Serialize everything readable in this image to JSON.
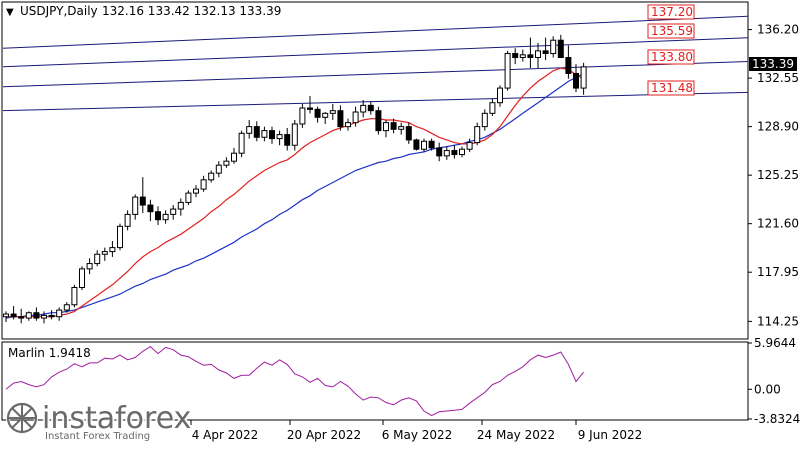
{
  "header": {
    "arrow": "▼",
    "symbol_tf": "USDJPY,Daily",
    "ohlc": "132.16 133.42 132.13 133.39"
  },
  "indicator": {
    "title": "Marlin 1.9418"
  },
  "watermark": {
    "brand": "instaforex",
    "tagline": "Instant Forex Trading"
  },
  "colors": {
    "background": "#ffffff",
    "grid": "#000000",
    "candle": "#000000",
    "ma_fast": "#e0201f",
    "ma_slow": "#1e33c8",
    "levels": "#1a1a7a",
    "level_label": "#e0201f",
    "oscillator": "#a01fa0"
  },
  "chart_data": [
    {
      "type": "candlestick",
      "title": "USDJPY,Daily",
      "ylim": [
        113.0,
        138.2
      ],
      "y_ticks": [
        "136.20",
        "132.55",
        "128.90",
        "125.25",
        "121.60",
        "117.95",
        "114.25"
      ],
      "x_ticks": [
        "4 Apr 2022",
        "20 Apr 2022",
        "6 May 2022",
        "24 May 2022",
        "9 Jun 2022"
      ],
      "current_price": "133.39",
      "level_labels": [
        "137.20",
        "135.59",
        "133.80",
        "131.48"
      ],
      "candles": [
        [
          114.6,
          115.0,
          114.2,
          114.8
        ],
        [
          114.8,
          115.4,
          114.4,
          114.6
        ],
        [
          114.6,
          115.2,
          114.1,
          114.5
        ],
        [
          114.5,
          115.0,
          114.3,
          114.9
        ],
        [
          114.9,
          115.3,
          114.3,
          114.5
        ],
        [
          114.5,
          115.0,
          114.1,
          114.7
        ],
        [
          114.7,
          115.1,
          114.4,
          114.6
        ],
        [
          114.6,
          115.3,
          114.3,
          115.1
        ],
        [
          115.1,
          115.7,
          114.9,
          115.5
        ],
        [
          115.5,
          117.0,
          115.3,
          116.8
        ],
        [
          116.8,
          118.4,
          116.6,
          118.2
        ],
        [
          118.2,
          119.0,
          117.8,
          118.6
        ],
        [
          118.6,
          119.6,
          118.4,
          119.3
        ],
        [
          119.3,
          119.8,
          118.8,
          119.5
        ],
        [
          119.5,
          120.3,
          119.1,
          119.8
        ],
        [
          119.8,
          121.6,
          119.6,
          121.4
        ],
        [
          121.4,
          122.6,
          121.1,
          122.3
        ],
        [
          122.3,
          123.8,
          121.9,
          123.6
        ],
        [
          123.6,
          125.1,
          122.4,
          123.0
        ],
        [
          123.0,
          123.4,
          121.8,
          122.5
        ],
        [
          122.5,
          122.9,
          121.5,
          121.9
        ],
        [
          121.9,
          122.6,
          121.6,
          122.3
        ],
        [
          122.3,
          123.0,
          121.9,
          122.7
        ],
        [
          122.7,
          123.5,
          122.2,
          123.2
        ],
        [
          123.2,
          124.1,
          123.0,
          123.9
        ],
        [
          123.9,
          124.5,
          123.6,
          124.2
        ],
        [
          124.2,
          125.2,
          124.0,
          124.9
        ],
        [
          124.9,
          125.6,
          124.7,
          125.4
        ],
        [
          125.4,
          126.3,
          125.1,
          126.0
        ],
        [
          126.0,
          126.6,
          125.8,
          126.3
        ],
        [
          126.3,
          127.3,
          126.1,
          126.9
        ],
        [
          126.9,
          128.6,
          126.6,
          128.4
        ],
        [
          128.4,
          129.4,
          128.0,
          128.9
        ],
        [
          128.9,
          129.3,
          127.8,
          128.1
        ],
        [
          128.1,
          128.9,
          127.8,
          128.6
        ],
        [
          128.6,
          128.9,
          127.6,
          128.0
        ],
        [
          128.0,
          128.6,
          127.5,
          128.3
        ],
        [
          128.3,
          128.8,
          127.1,
          127.5
        ],
        [
          127.5,
          129.4,
          127.1,
          129.1
        ],
        [
          129.1,
          130.6,
          128.8,
          130.3
        ],
        [
          130.3,
          131.2,
          129.9,
          130.2
        ],
        [
          130.2,
          130.4,
          129.2,
          129.6
        ],
        [
          129.6,
          130.0,
          129.1,
          129.9
        ],
        [
          129.9,
          130.6,
          129.4,
          130.1
        ],
        [
          130.1,
          130.5,
          128.6,
          128.9
        ],
        [
          128.9,
          129.5,
          128.6,
          129.2
        ],
        [
          129.2,
          130.4,
          128.9,
          130.0
        ],
        [
          130.0,
          130.9,
          129.6,
          130.5
        ],
        [
          130.5,
          130.8,
          129.8,
          130.1
        ],
        [
          130.1,
          130.4,
          128.3,
          128.6
        ],
        [
          128.6,
          129.4,
          128.1,
          129.2
        ],
        [
          129.2,
          129.5,
          128.4,
          128.7
        ],
        [
          128.7,
          129.2,
          128.3,
          128.9
        ],
        [
          128.9,
          129.2,
          127.6,
          127.9
        ],
        [
          127.9,
          128.0,
          127.1,
          127.2
        ],
        [
          127.2,
          128.0,
          127.0,
          127.8
        ],
        [
          127.8,
          128.0,
          127.1,
          127.3
        ],
        [
          127.3,
          127.7,
          126.3,
          126.7
        ],
        [
          126.7,
          127.4,
          126.4,
          127.1
        ],
        [
          127.1,
          127.5,
          126.5,
          126.8
        ],
        [
          126.8,
          127.4,
          126.6,
          127.2
        ],
        [
          127.2,
          128.0,
          127.0,
          127.7
        ],
        [
          127.7,
          129.2,
          127.5,
          128.9
        ],
        [
          128.9,
          130.2,
          128.6,
          129.9
        ],
        [
          129.9,
          131.0,
          129.7,
          130.7
        ],
        [
          130.7,
          132.0,
          130.4,
          131.8
        ],
        [
          131.8,
          134.6,
          131.6,
          134.4
        ],
        [
          134.4,
          134.8,
          133.6,
          134.1
        ],
        [
          134.1,
          134.7,
          133.8,
          134.3
        ],
        [
          134.3,
          135.6,
          133.3,
          134.1
        ],
        [
          134.1,
          135.2,
          133.3,
          134.6
        ],
        [
          134.6,
          135.6,
          133.9,
          134.4
        ],
        [
          134.4,
          135.7,
          134.1,
          135.4
        ],
        [
          135.4,
          135.8,
          134.3,
          134.1
        ],
        [
          134.1,
          135.0,
          132.5,
          132.9
        ],
        [
          132.9,
          133.6,
          131.5,
          131.8
        ],
        [
          131.8,
          133.7,
          131.3,
          133.4
        ]
      ],
      "ma_fast": [
        114.6,
        114.6,
        114.6,
        114.6,
        114.6,
        114.6,
        114.6,
        114.7,
        114.8,
        115.0,
        115.4,
        115.8,
        116.2,
        116.6,
        117.0,
        117.5,
        118.0,
        118.6,
        119.1,
        119.5,
        119.8,
        120.2,
        120.5,
        120.8,
        121.2,
        121.6,
        122.0,
        122.5,
        122.9,
        123.4,
        123.8,
        124.3,
        124.8,
        125.2,
        125.6,
        125.9,
        126.2,
        126.4,
        126.8,
        127.3,
        127.7,
        128.0,
        128.3,
        128.6,
        128.8,
        129.0,
        129.2,
        129.4,
        129.5,
        129.5,
        129.4,
        129.4,
        129.3,
        129.2,
        128.9,
        128.7,
        128.4,
        128.1,
        127.9,
        127.7,
        127.6,
        127.6,
        127.7,
        127.9,
        128.3,
        128.9,
        129.7,
        130.5,
        131.2,
        131.8,
        132.3,
        132.7,
        133.1,
        133.3,
        133.2,
        132.8,
        132.5
      ],
      "ma_slow": [
        114.5,
        114.6,
        114.6,
        114.7,
        114.7,
        114.8,
        114.9,
        114.9,
        115.0,
        115.1,
        115.3,
        115.5,
        115.7,
        115.9,
        116.1,
        116.3,
        116.6,
        116.9,
        117.1,
        117.4,
        117.6,
        117.8,
        118.1,
        118.3,
        118.5,
        118.8,
        119.0,
        119.3,
        119.6,
        119.9,
        120.2,
        120.6,
        120.9,
        121.2,
        121.6,
        121.9,
        122.3,
        122.6,
        123.0,
        123.4,
        123.7,
        124.1,
        124.4,
        124.7,
        125.0,
        125.3,
        125.6,
        125.8,
        126.0,
        126.2,
        126.3,
        126.5,
        126.6,
        126.8,
        126.9,
        127.0,
        127.2,
        127.3,
        127.4,
        127.5,
        127.6,
        127.8,
        127.9,
        128.1,
        128.4,
        128.7,
        129.1,
        129.5,
        129.9,
        130.3,
        130.7,
        131.1,
        131.5,
        131.9,
        132.3,
        132.6,
        132.9
      ],
      "level_lines": [
        {
          "label": "137.20",
          "y0": 134.8,
          "y1": 137.2
        },
        {
          "label": "135.59",
          "y0": 133.4,
          "y1": 135.59
        },
        {
          "label": "133.80",
          "y0": 131.9,
          "y1": 133.8
        },
        {
          "label": "131.48",
          "y0": 130.1,
          "y1": 131.48
        }
      ]
    },
    {
      "type": "line",
      "title": "Marlin 1.9418",
      "ylim": [
        -3.8324,
        5.9644
      ],
      "y_ticks": [
        "5.9644",
        "0.00",
        "-3.8324"
      ],
      "values": [
        0.0,
        0.8,
        1.0,
        0.6,
        0.3,
        0.6,
        1.6,
        2.2,
        2.6,
        3.3,
        2.9,
        3.4,
        3.4,
        4.0,
        3.9,
        4.4,
        3.8,
        4.1,
        4.9,
        5.5,
        4.6,
        5.4,
        5.1,
        4.4,
        4.2,
        3.6,
        3.1,
        3.2,
        2.5,
        2.1,
        1.4,
        1.8,
        1.8,
        2.7,
        3.5,
        3.1,
        3.8,
        3.2,
        2.0,
        1.6,
        0.9,
        1.4,
        0.5,
        0.3,
        1.0,
        0.4,
        -0.6,
        -1.4,
        -1.0,
        -1.1,
        -1.7,
        -2.0,
        -1.4,
        -1.1,
        -1.5,
        -2.8,
        -3.4,
        -2.9,
        -2.8,
        -2.7,
        -2.6,
        -1.8,
        -1.1,
        -0.4,
        0.6,
        1.0,
        1.8,
        2.3,
        2.9,
        3.8,
        4.4,
        4.1,
        4.4,
        4.8,
        3.2,
        1.0,
        2.2
      ]
    }
  ]
}
